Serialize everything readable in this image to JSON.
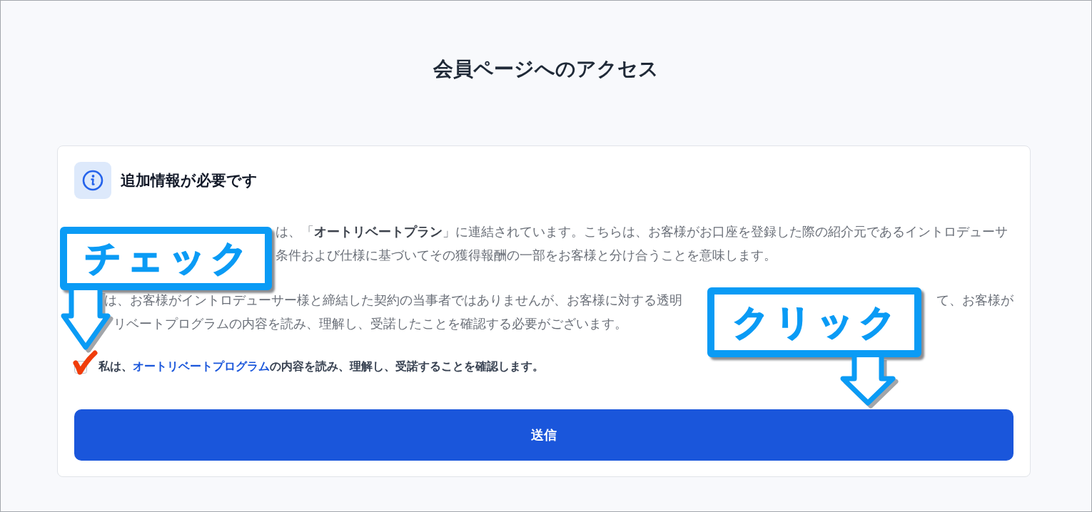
{
  "page": {
    "title": "会員ページへのアクセス"
  },
  "notice": {
    "title": "追加情報が必要です",
    "paragraphs": [
      {
        "lines": [
          {
            "segments": [
              "は、「**オートリベートプラン**」に連結されています。こちらは、お客様がお口座を登録した際の紹介元であるイントロデューサ"
            ]
          },
          {
            "segments": [
              "条件および仕様に基づいてその獲得報酬の一部をお客様と分け合うことを意味します。"
            ]
          }
        ]
      },
      {
        "lines": [
          {
            "segments": [
              "は、お客様がイントロデューサー様と締結した契約の当事者ではありませんが、お客様に対する透明",
              "て、お客様が"
            ]
          },
          {
            "segments": [
              "リベートプログラムの内容を読み、理解し、受諾したことを確認する必要がございます。"
            ]
          }
        ]
      }
    ],
    "agreement": {
      "checked": true,
      "text_before": "私は、",
      "link": "オートリベートプログラム",
      "text_after": "の内容を読み、理解し、受諾することを確認します。"
    },
    "submit_button": "送信"
  },
  "annotations": [
    {
      "kind": "callout",
      "label": "チェック"
    },
    {
      "kind": "callout",
      "label": "クリック"
    }
  ]
}
